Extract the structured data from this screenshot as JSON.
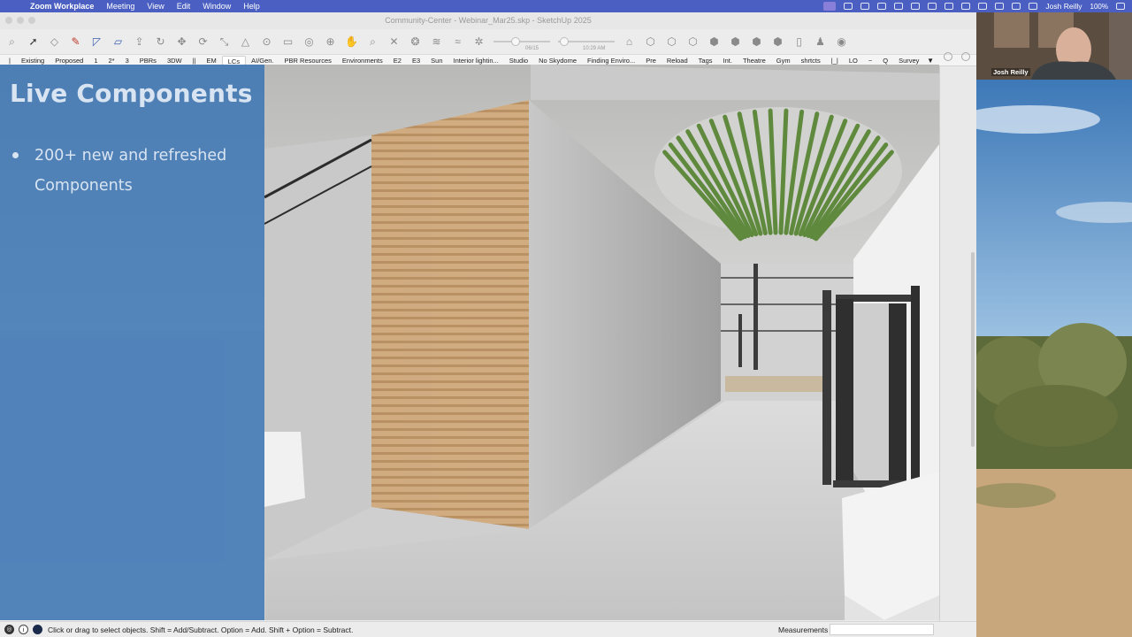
{
  "menubar": {
    "app_name": "Zoom Workplace",
    "items": [
      "Meeting",
      "View",
      "Edit",
      "Window",
      "Help"
    ],
    "user": "Josh Reilly",
    "battery": "100%"
  },
  "window": {
    "title": "Community-Center - Webinar_Mar25.skp - SketchUp 2025"
  },
  "toolbar": {
    "shadow_start_label": "06/15",
    "shadow_time_label": "10:29 AM"
  },
  "scenes": [
    {
      "label": "|",
      "active": false
    },
    {
      "label": "Existing",
      "active": false
    },
    {
      "label": "Proposed",
      "active": false
    },
    {
      "label": "1",
      "active": false
    },
    {
      "label": "2*",
      "active": false
    },
    {
      "label": "3",
      "active": false
    },
    {
      "label": "PBRs",
      "active": false
    },
    {
      "label": "3DW",
      "active": false
    },
    {
      "label": "||",
      "active": false
    },
    {
      "label": "EM",
      "active": false
    },
    {
      "label": "LCs",
      "active": true
    },
    {
      "label": "AI/Gen.",
      "active": false
    },
    {
      "label": "PBR Resources",
      "active": false
    },
    {
      "label": "Environments",
      "active": false
    },
    {
      "label": "E2",
      "active": false
    },
    {
      "label": "E3",
      "active": false
    },
    {
      "label": "Sun",
      "active": false
    },
    {
      "label": "Interior lightin...",
      "active": false
    },
    {
      "label": "Studio",
      "active": false
    },
    {
      "label": "No Skydome",
      "active": false
    },
    {
      "label": "Finding Enviro...",
      "active": false
    },
    {
      "label": "Pre",
      "active": false
    },
    {
      "label": "Reload",
      "active": false
    },
    {
      "label": "Tags",
      "active": false
    },
    {
      "label": "Int.",
      "active": false
    },
    {
      "label": "Theatre",
      "active": false
    },
    {
      "label": "Gym",
      "active": false
    },
    {
      "label": "shrtcts",
      "active": false
    },
    {
      "label": "|_|",
      "active": false
    },
    {
      "label": "LO",
      "active": false
    },
    {
      "label": "~",
      "active": false
    },
    {
      "label": "Q",
      "active": false
    },
    {
      "label": "Survey",
      "active": false
    }
  ],
  "scenes_more": "▼",
  "slide": {
    "title": "Live Components",
    "bullet_line1": "200+ new and refreshed",
    "bullet_line2": "Components"
  },
  "status": {
    "hint": "Click or drag to select objects. Shift = Add/Subtract. Option = Add. Shift + Option = Subtract.",
    "measurements_label": "Measurements"
  },
  "webcam": {
    "name": "Josh Reilly"
  },
  "toolbar_icons": [
    "search-icon",
    "select-arrow-icon",
    "eraser-icon",
    "pencil-icon",
    "line-icon",
    "rectangle-icon",
    "push-pull-icon",
    "follow-me-icon",
    "move-icon",
    "rotate-icon",
    "scale-icon",
    "offset-icon",
    "tape-icon",
    "text-icon",
    "paint-icon",
    "orbit-icon",
    "pan-icon",
    "zoom-icon",
    "zoom-extents-icon",
    "section-icon",
    "sandbox-icon",
    "smoove-icon",
    "stamp-icon"
  ],
  "colors": {
    "menubar": "#4a5fc1",
    "slide_panel": "#2e6eb4",
    "wood_slats": "#c9a57a",
    "planter_green": "#5f8a3e"
  }
}
